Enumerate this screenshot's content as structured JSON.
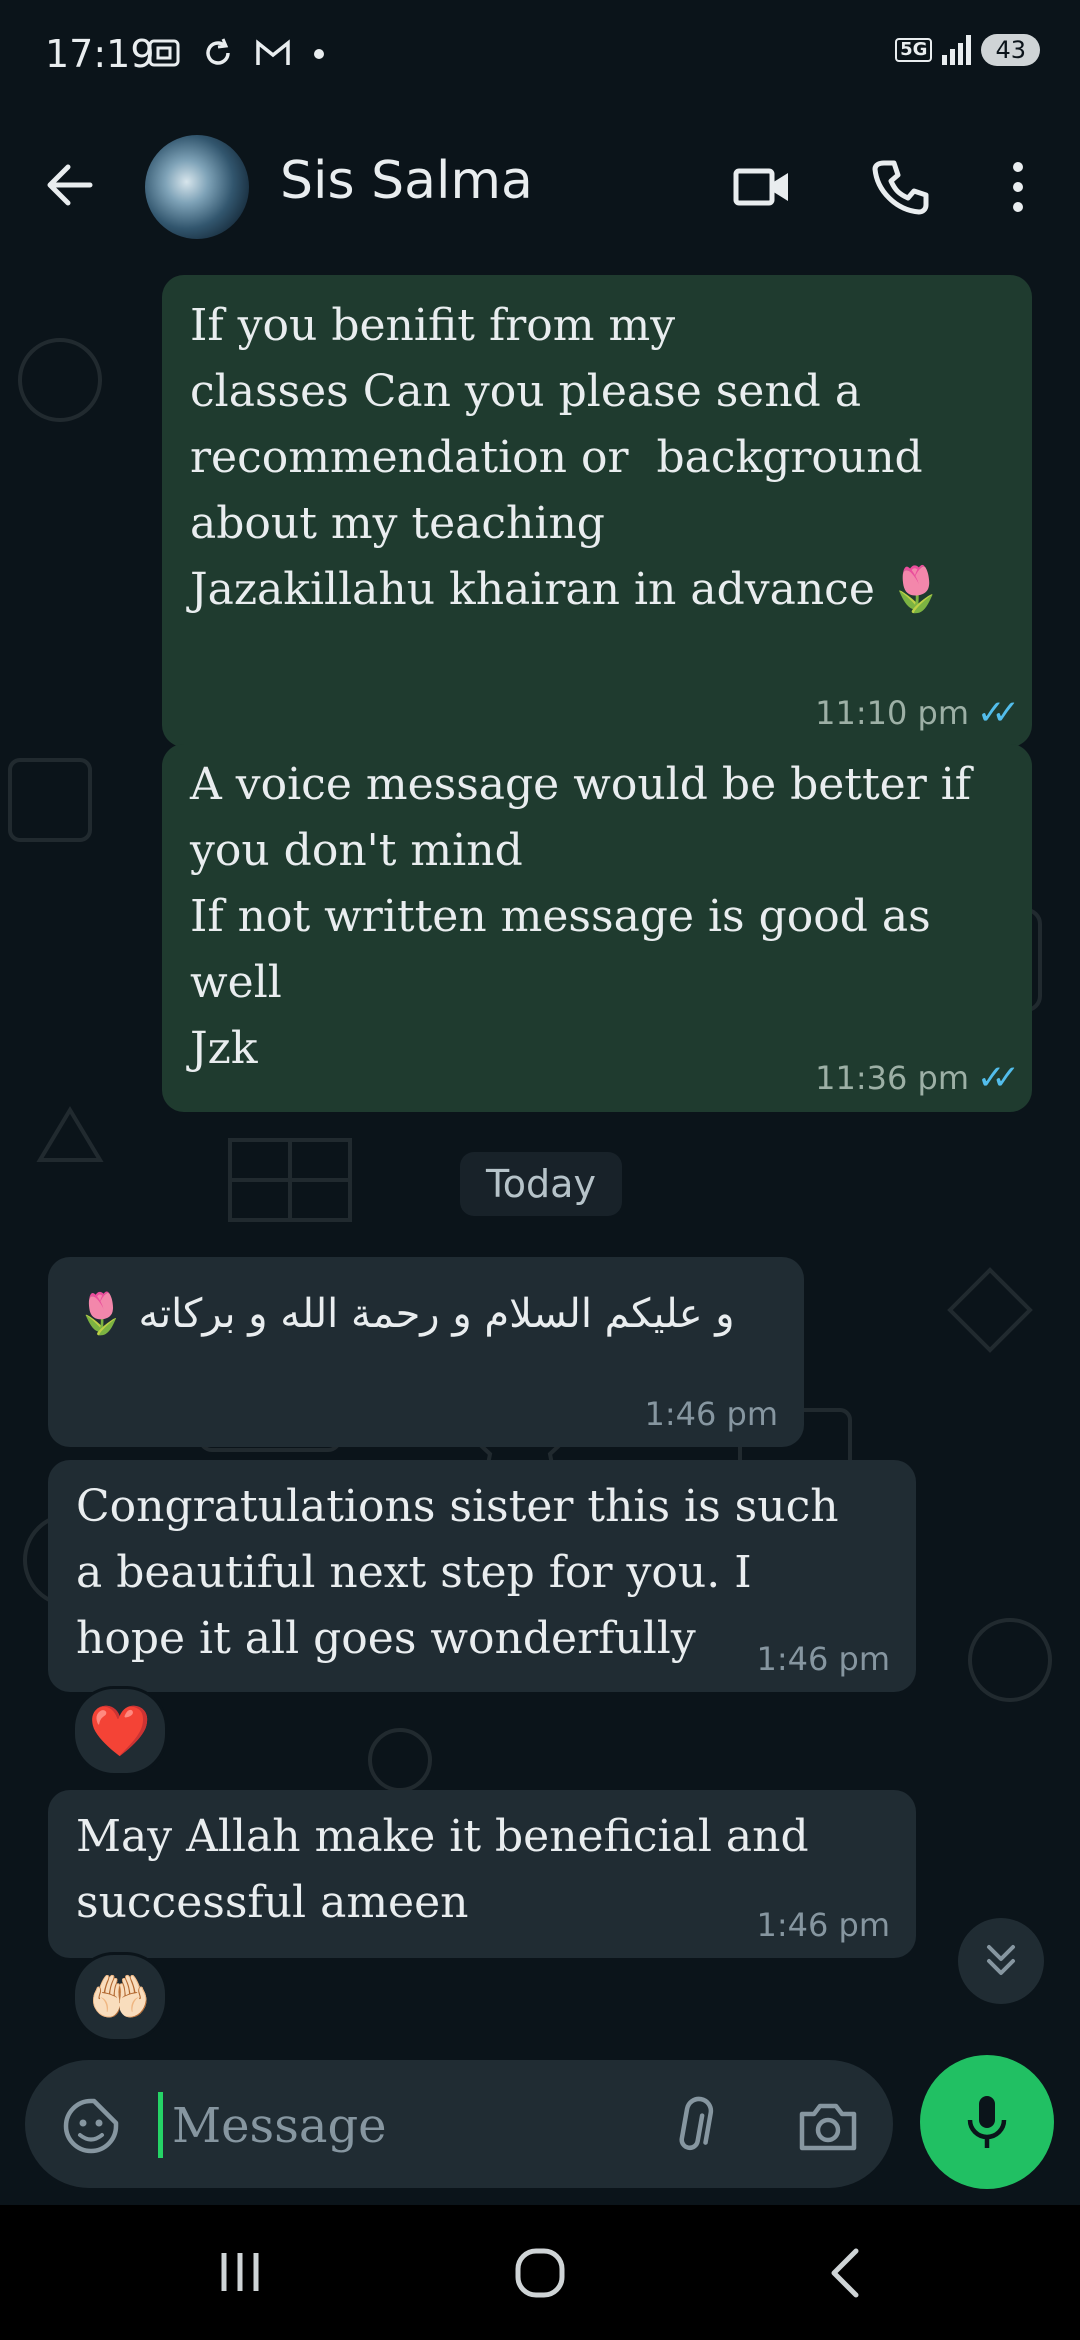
{
  "status_bar": {
    "time": "17:19",
    "network": "5G",
    "battery": "43"
  },
  "header": {
    "contact_name": "Sis Salma",
    "icons": [
      "back-arrow-icon",
      "video-call-icon",
      "phone-icon",
      "more-options-icon"
    ]
  },
  "messages": [
    {
      "direction": "outgoing",
      "text": "If you benifit from my\nclasses Can you please send a\nrecommendation or  background\nabout my teaching\nJazakillahu khairan in advance 🌷",
      "time": "11:10 pm",
      "read": true
    },
    {
      "direction": "outgoing",
      "text": "A voice message would be better if\nyou don't mind\nIf not written message is good as\nwell\nJzk",
      "time": "11:36 pm",
      "read": true
    },
    {
      "direction": "incoming",
      "text": "🌷 و عليكم السلام و رحمة الله و بركاته",
      "time": "1:46 pm"
    },
    {
      "direction": "incoming",
      "text": "Congratulations sister this is such\na beautiful next step for you. I\nhope it all goes wonderfully",
      "time": "1:46 pm",
      "reaction": "❤️"
    },
    {
      "direction": "incoming",
      "text": "May Allah make it beneficial and\nsuccessful ameen",
      "time": "1:46 pm",
      "reaction": "🤲🏻"
    }
  ],
  "date_divider": "Today",
  "composer": {
    "placeholder": "Message"
  },
  "colors": {
    "background": "#0b141a",
    "outgoing_bubble": "#1f3b2f",
    "incoming_bubble": "#202c33",
    "read_ticks": "#53bdeb",
    "accent": "#21c063"
  }
}
